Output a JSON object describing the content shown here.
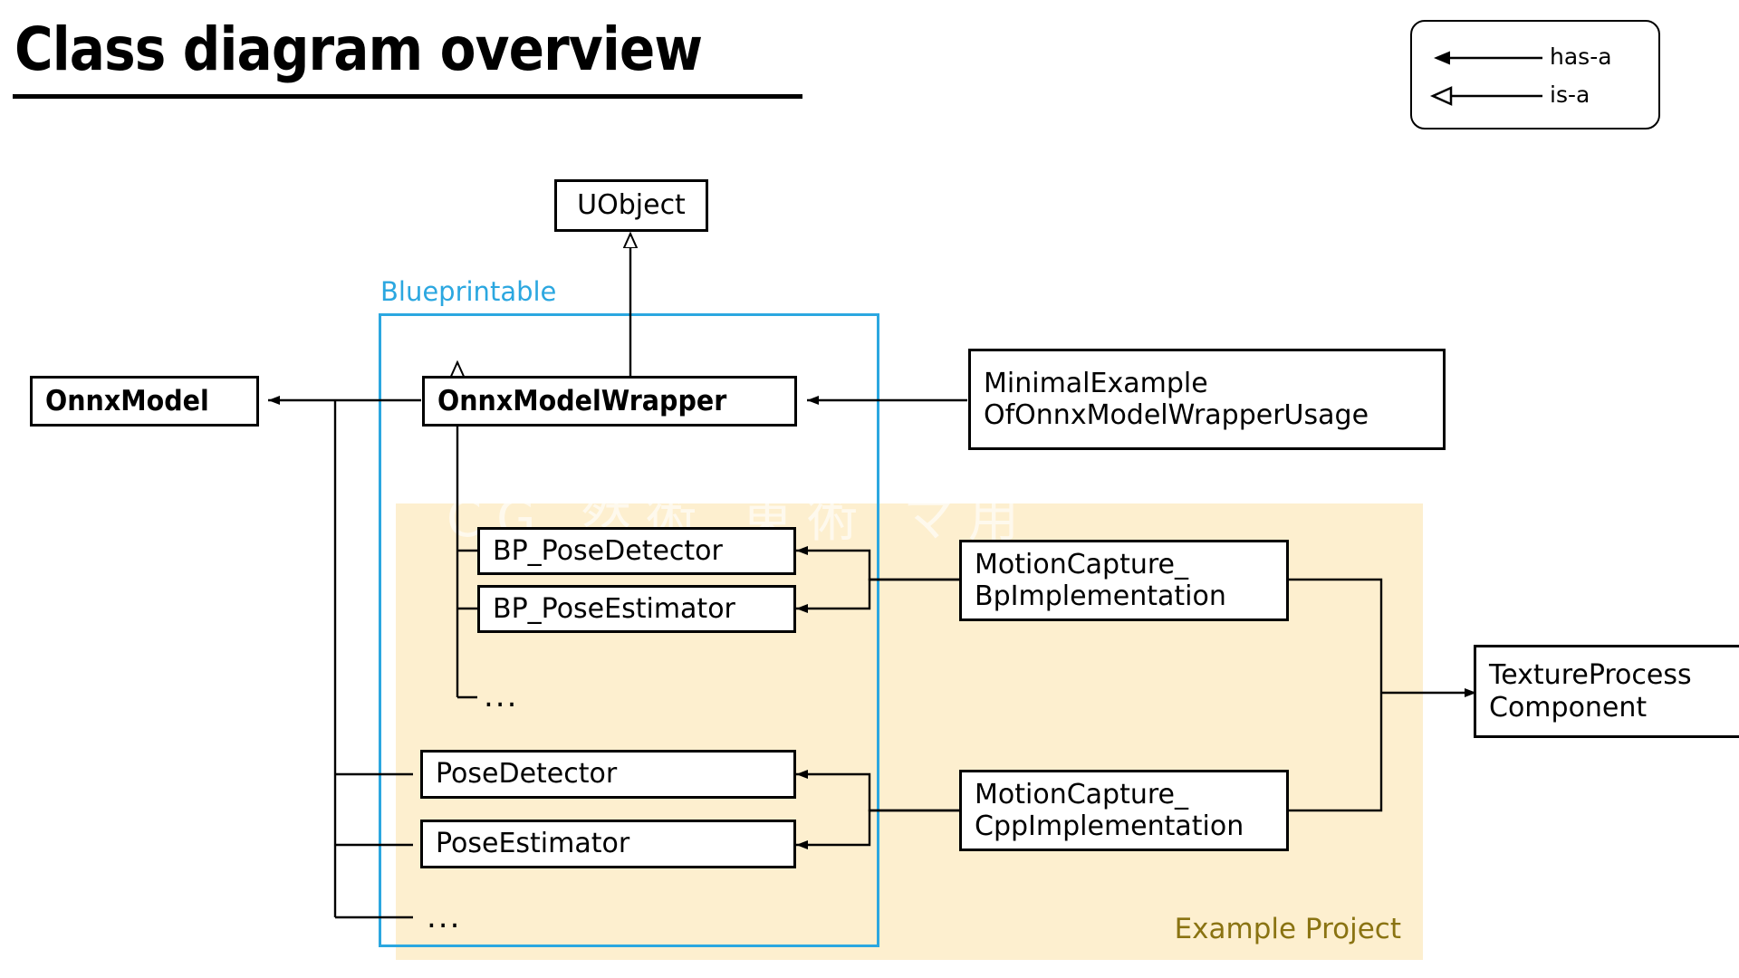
{
  "page": {
    "title": "Class diagram overview",
    "background": "#ffffff"
  },
  "legend": {
    "rows": [
      {
        "id": "has-a",
        "label": "has-a",
        "arrow": "filled"
      },
      {
        "id": "is-a",
        "label": "is-a",
        "arrow": "hollow"
      }
    ]
  },
  "regions": {
    "blueprintable": {
      "label": "Blueprintable",
      "color": "#2ba7e0"
    },
    "example_project": {
      "label": "Example Project",
      "color": "#8a7312",
      "fill": "#fdefcf",
      "watermark": "CG 然術 東術 マ用"
    }
  },
  "nodes": {
    "uobject": {
      "label": "UObject"
    },
    "onnx_model": {
      "label": "OnnxModel"
    },
    "onnx_wrapper": {
      "label": "OnnxModelWrapper"
    },
    "minimal_example": {
      "label": "MinimalExample\nOfOnnxModelWrapperUsage"
    },
    "bp_pose_detector": {
      "label": "BP_PoseDetector"
    },
    "bp_pose_estimator": {
      "label": "BP_PoseEstimator"
    },
    "bp_more": {
      "label": "..."
    },
    "pose_detector": {
      "label": "PoseDetector"
    },
    "pose_estimator": {
      "label": "PoseEstimator"
    },
    "cpp_more": {
      "label": "..."
    },
    "mocap_bp": {
      "label": "MotionCapture_\nBpImplementation"
    },
    "mocap_cpp": {
      "label": "MotionCapture_\nCppImplementation"
    },
    "texture_process": {
      "label": "TextureProcess\nComponent"
    }
  },
  "relations": [
    {
      "from": "onnx_wrapper",
      "to": "uobject",
      "type": "is-a"
    },
    {
      "from": "onnx_wrapper",
      "to": "onnx_model",
      "type": "has-a"
    },
    {
      "from": "minimal_example",
      "to": "onnx_wrapper",
      "type": "has-a"
    },
    {
      "from": "bp_pose_detector",
      "to": "onnx_wrapper",
      "type": "is-a"
    },
    {
      "from": "bp_pose_estimator",
      "to": "onnx_wrapper",
      "type": "is-a"
    },
    {
      "from": "bp_more",
      "to": "onnx_wrapper",
      "type": "is-a"
    },
    {
      "from": "pose_detector",
      "to": "onnx_model",
      "type": "has-a"
    },
    {
      "from": "pose_estimator",
      "to": "onnx_model",
      "type": "has-a"
    },
    {
      "from": "cpp_more",
      "to": "onnx_model",
      "type": "has-a"
    },
    {
      "from": "mocap_bp",
      "to": "bp_pose_detector",
      "type": "has-a"
    },
    {
      "from": "mocap_bp",
      "to": "bp_pose_estimator",
      "type": "has-a"
    },
    {
      "from": "mocap_cpp",
      "to": "pose_detector",
      "type": "has-a"
    },
    {
      "from": "mocap_cpp",
      "to": "pose_estimator",
      "type": "has-a"
    },
    {
      "from": "mocap_bp",
      "to": "texture_process",
      "type": "has-a"
    },
    {
      "from": "mocap_cpp",
      "to": "texture_process",
      "type": "has-a"
    }
  ]
}
